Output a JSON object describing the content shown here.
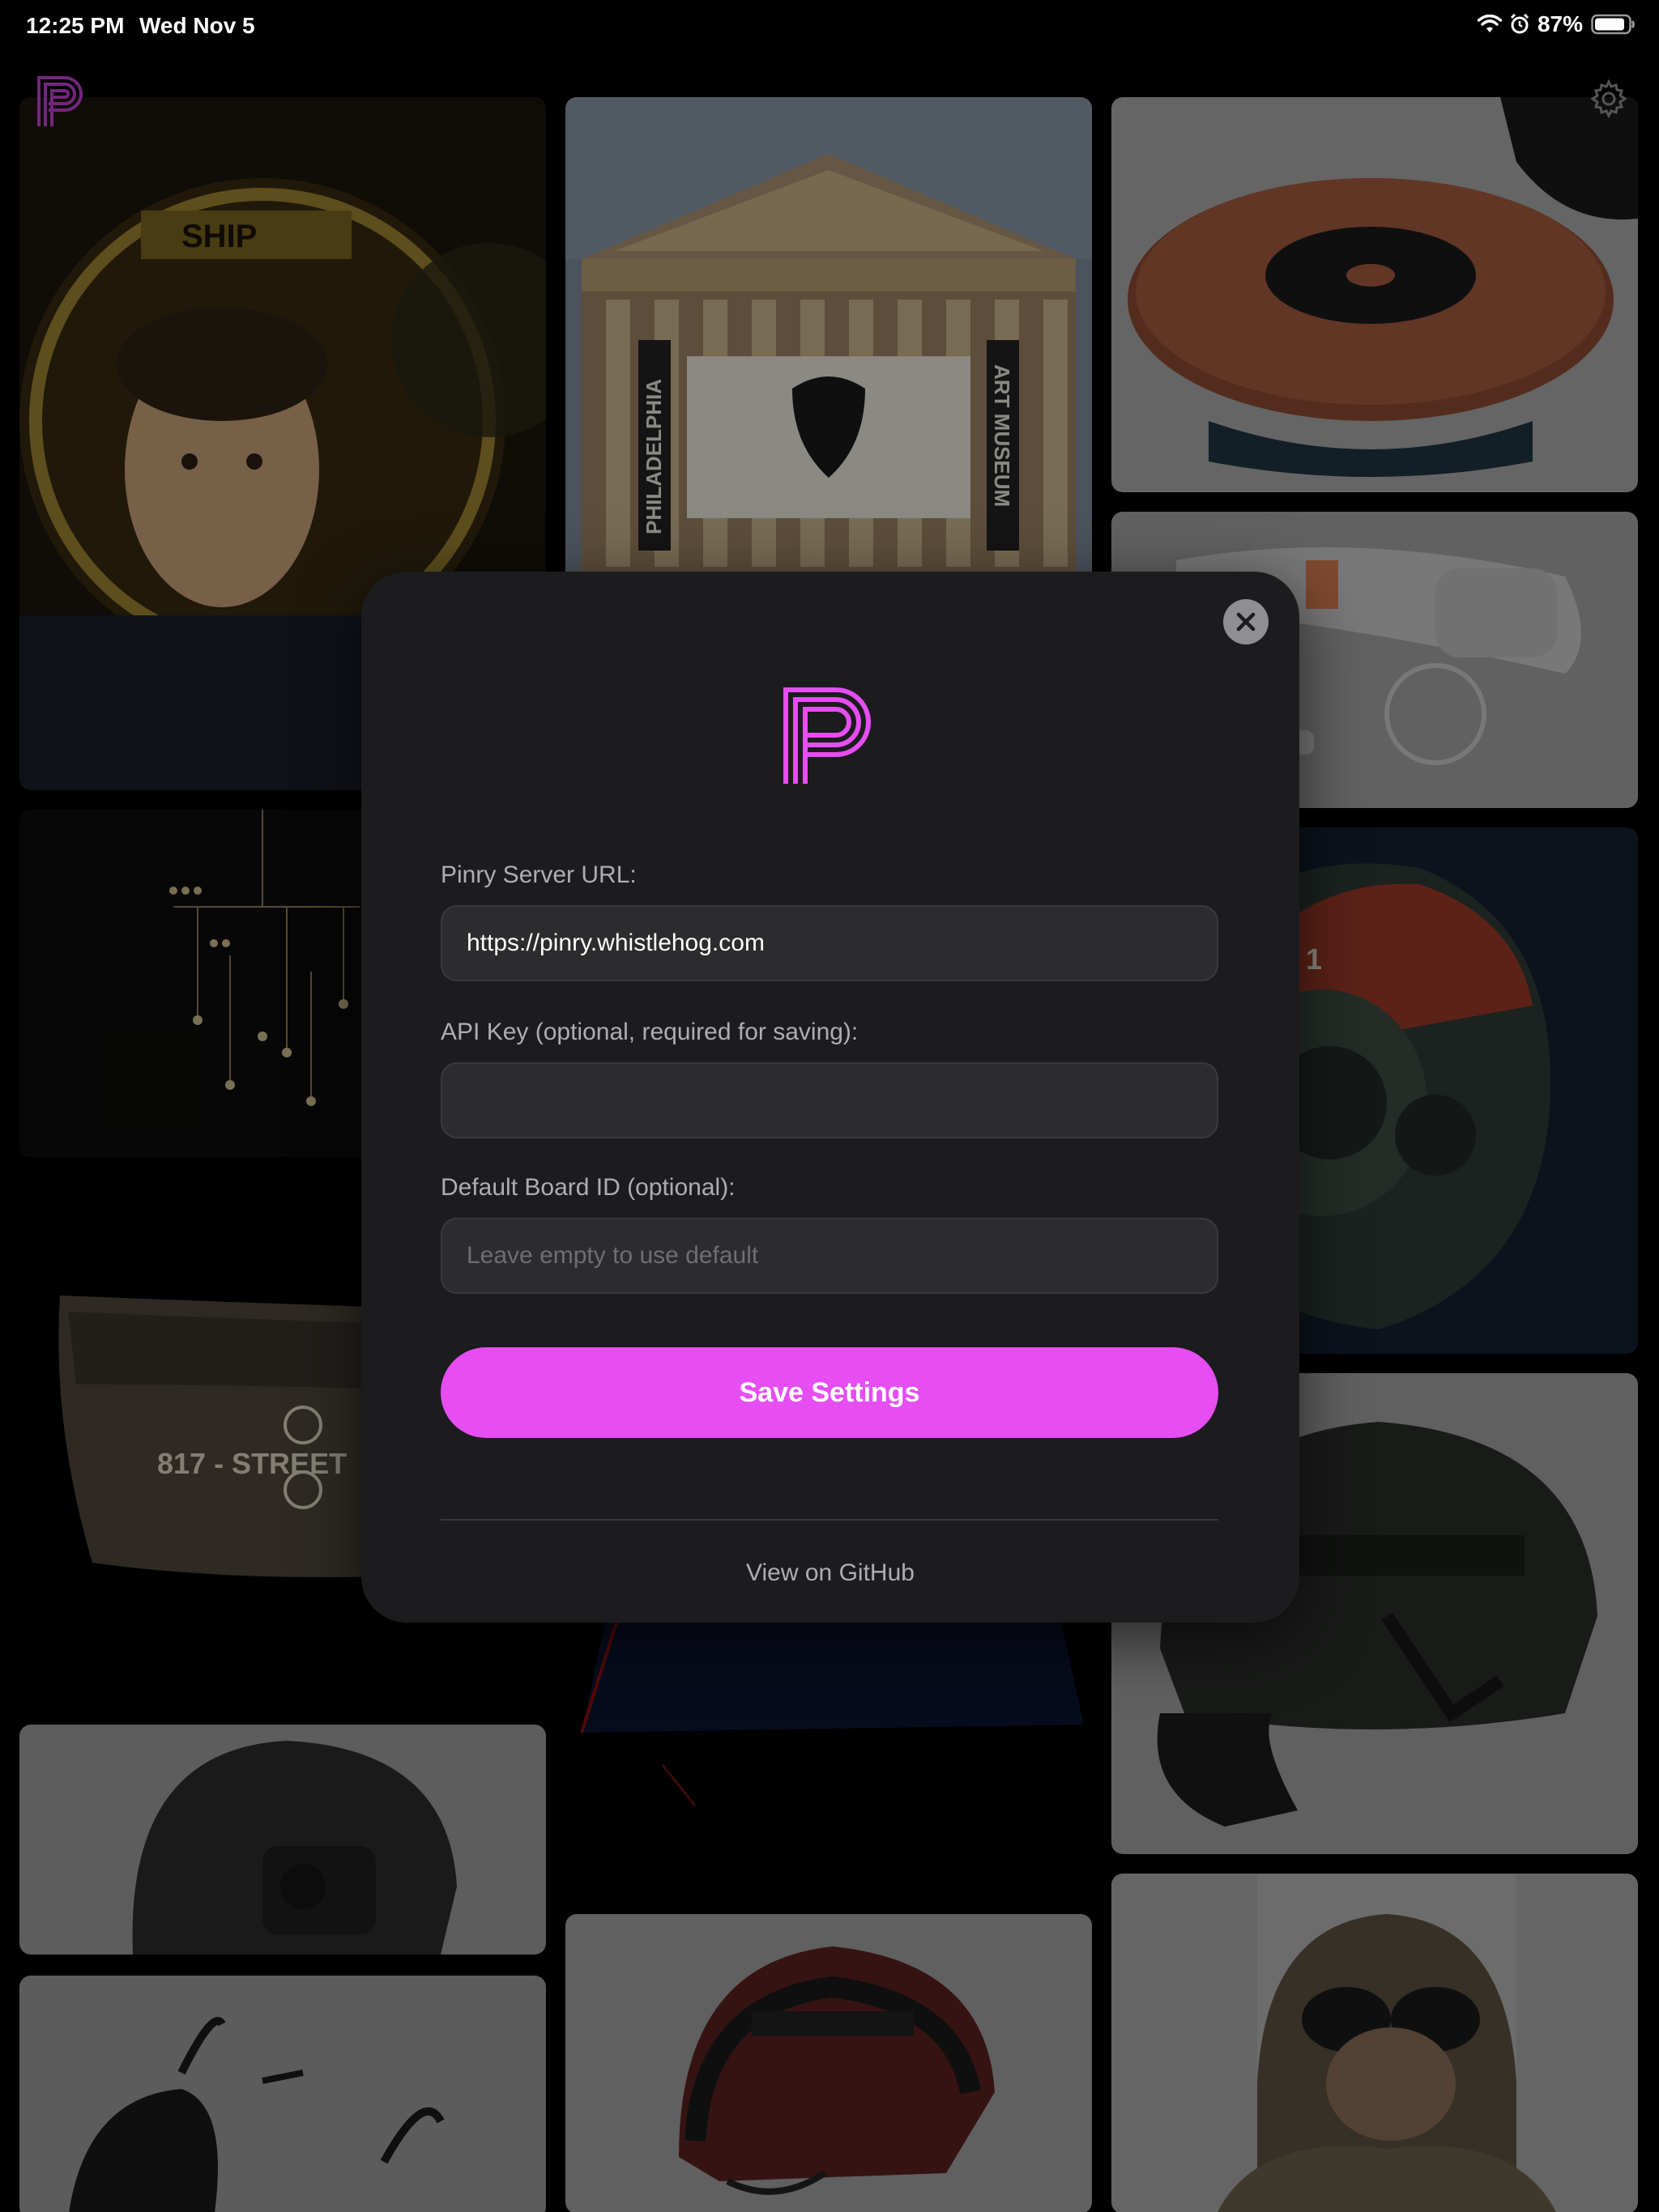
{
  "status_bar": {
    "time": "12:25 PM",
    "date": "Wed Nov 5",
    "battery_percent": "87%",
    "icons": [
      "wifi-icon",
      "alarm-icon",
      "battery-icon"
    ]
  },
  "header": {
    "logo_icon": "pinry-logo-icon",
    "settings_icon": "gear-icon"
  },
  "gallery": {
    "tiles": [
      {
        "subject": "astronaut-helmet",
        "overlay_text": "SHIP"
      },
      {
        "subject": "museum-building",
        "banner_left": "PHILADELPHIA",
        "banner_right": "ART MUSEUM"
      },
      {
        "subject": "turntable-record"
      },
      {
        "subject": "headset-band"
      },
      {
        "subject": "hanging-mobile"
      },
      {
        "subject": "robot-helmet",
        "overlay_text": "1"
      },
      {
        "subject": "visor-shield",
        "overlay_text": "817 - STREET"
      },
      {
        "subject": "dark-helmet"
      },
      {
        "subject": "tactical-helmet"
      },
      {
        "subject": "mesh-helmet"
      },
      {
        "subject": "red-tactical-helmet"
      },
      {
        "subject": "goggles-person"
      },
      {
        "subject": "strap-headgear"
      }
    ]
  },
  "modal": {
    "logo_icon": "pinry-logo-icon",
    "close_icon": "close-icon",
    "server_url": {
      "label": "Pinry Server URL:",
      "value": "https://pinry.whistlehog.com",
      "placeholder": ""
    },
    "api_key": {
      "label": "API Key (optional, required for saving):",
      "value": "",
      "placeholder": ""
    },
    "board_id": {
      "label": "Default Board ID (optional):",
      "value": "",
      "placeholder": "Leave empty to use default"
    },
    "save_label": "Save Settings",
    "github_link": "View on GitHub"
  },
  "colors": {
    "accent": "#e64df2",
    "modal_bg": "#1c1c1e",
    "input_bg": "#2c2c2e"
  }
}
